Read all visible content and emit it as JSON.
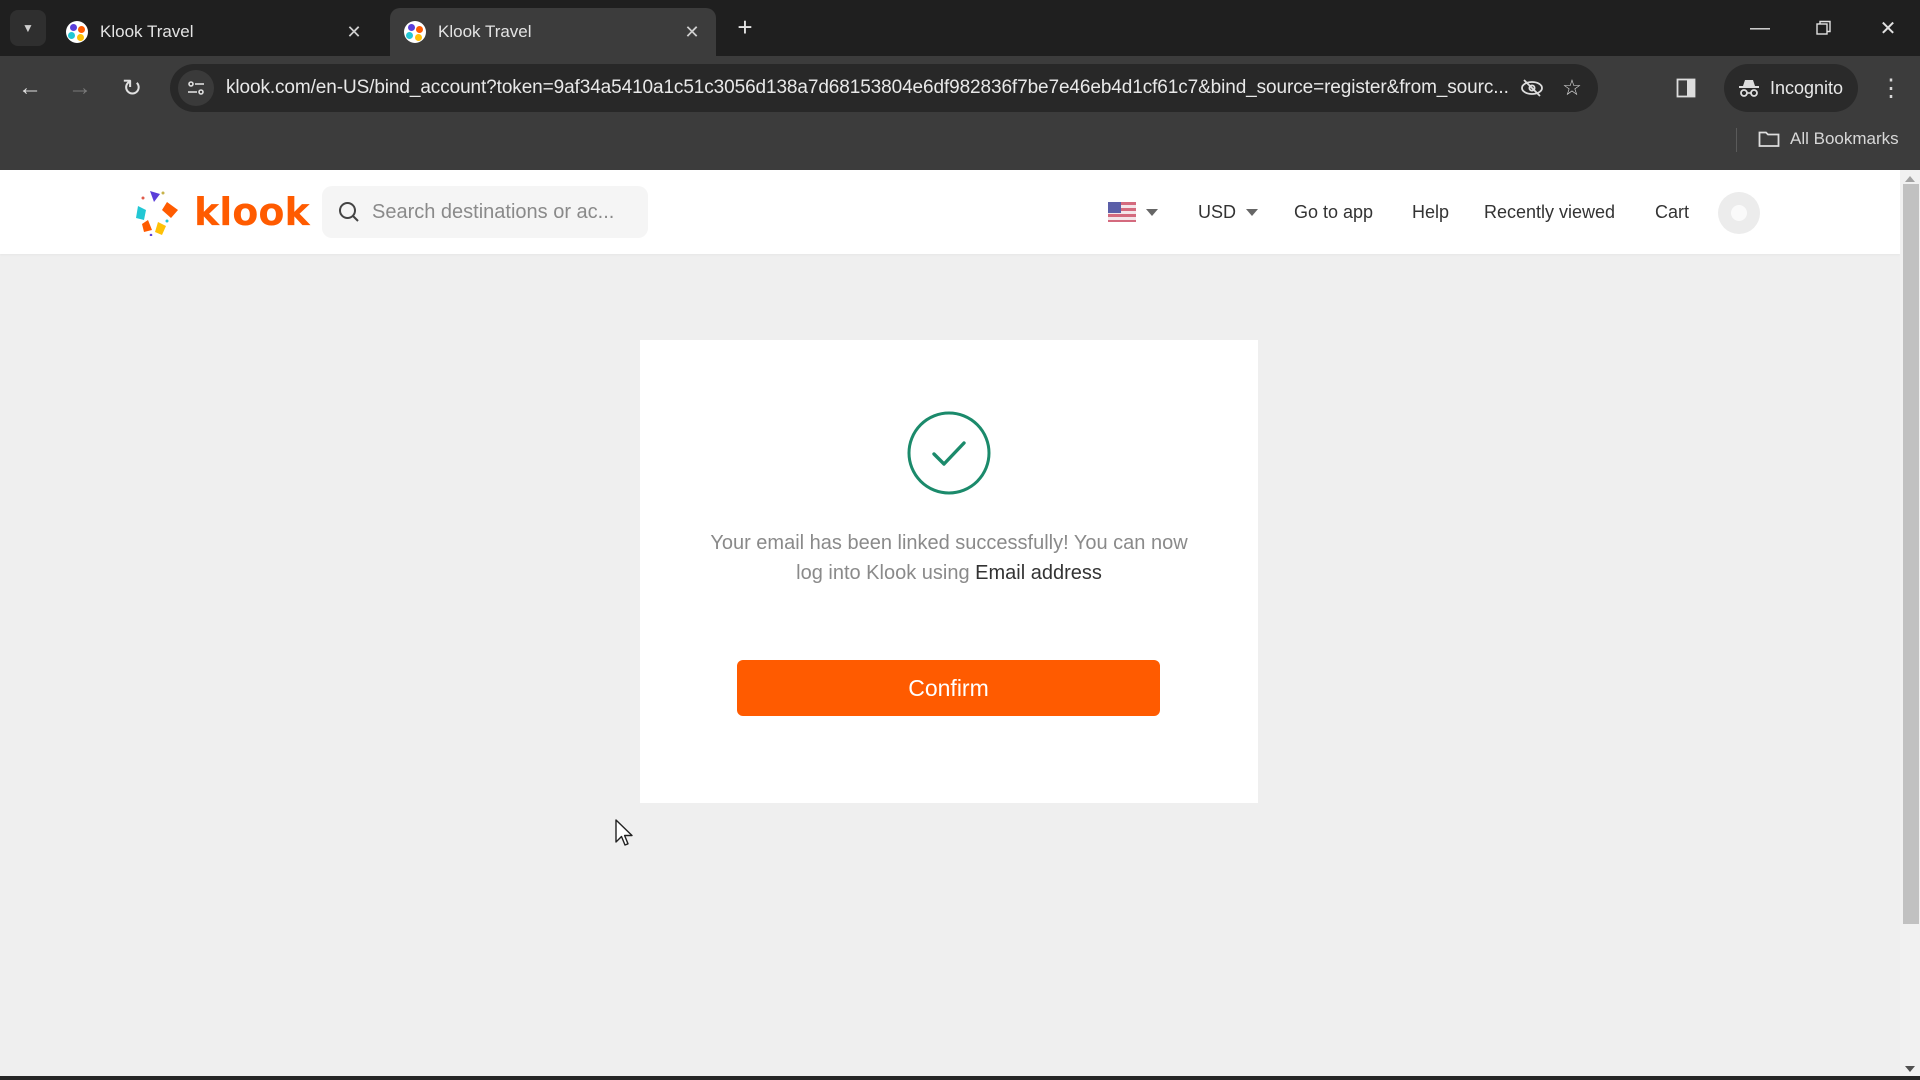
{
  "browser": {
    "tabs": [
      {
        "title": "Klook Travel",
        "active": false
      },
      {
        "title": "Klook Travel",
        "active": true
      }
    ],
    "new_tab_label": "+",
    "url": "klook.com/en-US/bind_account?token=9af34a5410a1c51c3056d138a7d68153804e6df982836f7be7e46eb4d1cf61c7&bind_source=register&from_sourc...",
    "incognito_label": "Incognito",
    "all_bookmarks_label": "All Bookmarks",
    "icons": {
      "tab_list": "chevron-down-icon",
      "back": "arrow-left-icon",
      "forward": "arrow-right-icon",
      "reload": "reload-icon",
      "site_info": "tune-icon",
      "tracking": "eye-off-icon",
      "bookmark": "star-icon",
      "side_panel": "side-panel-icon",
      "menu": "kebab-menu-icon"
    }
  },
  "site": {
    "logo_text": "klook",
    "search_placeholder": "Search destinations or ac...",
    "nav": {
      "language": "en-US",
      "currency": "USD",
      "go_to_app": "Go to app",
      "help": "Help",
      "recently_viewed": "Recently viewed",
      "cart": "Cart"
    }
  },
  "card": {
    "message_part1": "Your email has been linked successfully! You can now log into Klook using ",
    "message_emph": "Email address",
    "confirm_label": "Confirm",
    "status": "success"
  },
  "colors": {
    "brand": "#ff5b00",
    "success": "#1b8a6b",
    "page_bg": "#efefef"
  }
}
